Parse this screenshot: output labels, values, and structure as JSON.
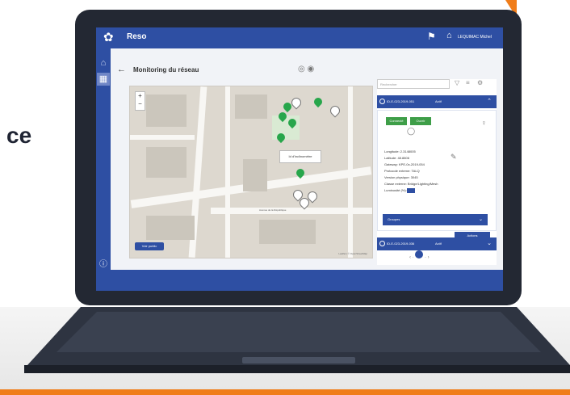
{
  "side_word": "ce",
  "app": {
    "title": "Reso",
    "user_name": "LEQUIMAC Michel"
  },
  "icons": {
    "logo": "app-logo",
    "alert": "alert-icon",
    "user": "user-icon",
    "home": "home-icon",
    "grid": "grid-icon",
    "help": "help-icon",
    "back": "back-arrow-icon"
  },
  "page": {
    "title": "Monitoring du réseau"
  },
  "map": {
    "popup": "Id d'inclinomètre",
    "button": "Voir public",
    "credit": "Leaflet | © OpenStreetMap",
    "road_name": "Avenue de la République"
  },
  "panel": {
    "search_placeholder": "Rechercher",
    "device1": {
      "id": "ID-E-023-2019-051",
      "state": "Actif"
    },
    "btn_connect": "Connecté",
    "btn_status": "Ouvrir",
    "details": [
      "Longitude: 2.3148005",
      "Latitude: 48.8806",
      "Gateway: KPE-0x-2019-054",
      "Protocole externe: TALQ",
      "Version physique: 3045",
      "Classe externe: Bridge/Lighting/Mesh",
      "Luminosité (%):"
    ],
    "select_label": "Groupes",
    "action_label": "Actions",
    "device2": {
      "id": "ID-E-023-2019-036",
      "state": "Actif"
    },
    "current_page": "2"
  },
  "colors": {
    "primary": "#2e4fa3",
    "accent": "#f07d1a",
    "green": "#27a64b"
  }
}
